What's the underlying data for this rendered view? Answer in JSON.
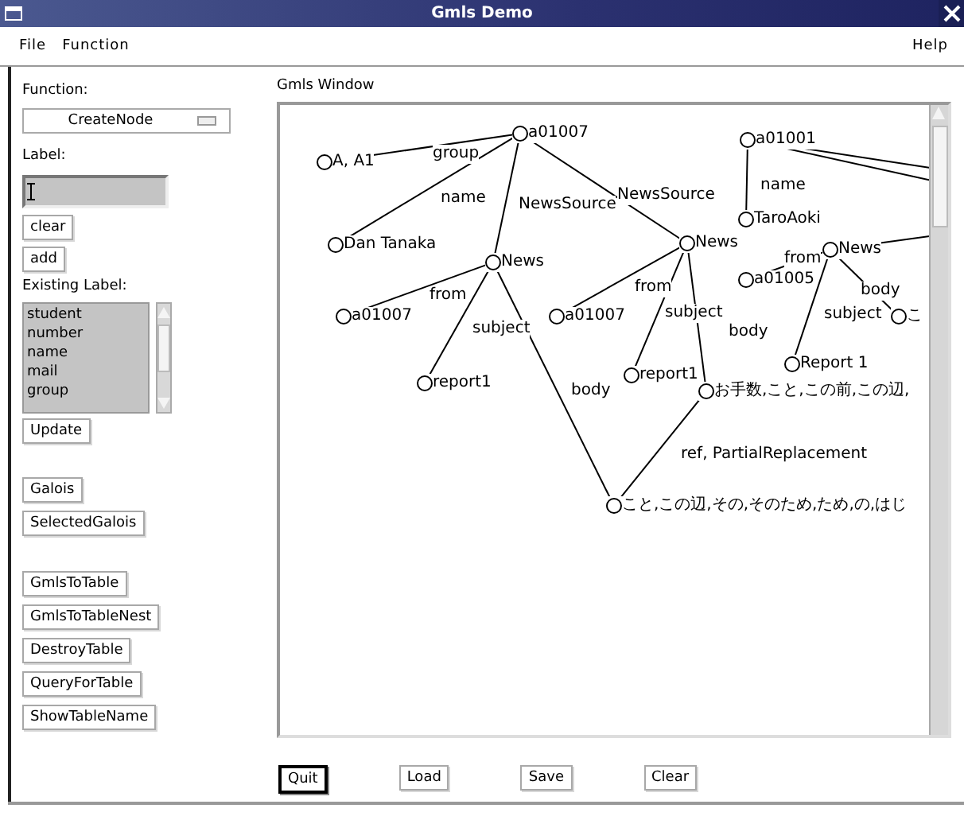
{
  "window": {
    "title": "Gmls Demo"
  },
  "menu_bar": {
    "left": [
      "File",
      "Function"
    ],
    "right": [
      "Help"
    ]
  },
  "sidebar": {
    "function_label": "Function:",
    "function_menu": {
      "value": "CreateNode"
    },
    "label_label": "Label:",
    "label_buttons": [
      "clear",
      "add"
    ],
    "existing_label": "Existing Label:",
    "existing_list": [
      "student",
      "number",
      "name",
      "mail",
      "group"
    ],
    "update_button": "Update",
    "galois_buttons": [
      "Galois",
      "SelectedGalois"
    ],
    "table_buttons": [
      "GmlsToTable",
      "GmlsToTableNest",
      "DestroyTable",
      "QueryForTable",
      "ShowTableName"
    ]
  },
  "graph": {
    "title": "Gmls Window",
    "nodes": [
      {
        "label": "a01007"
      },
      {
        "label": "a01001"
      },
      {
        "label": "A, A1"
      },
      {
        "label": "TaroAoki"
      },
      {
        "label": "Dan Tanaka"
      },
      {
        "label": "News"
      },
      {
        "label": "News"
      },
      {
        "label": "News"
      },
      {
        "label": "a01005"
      },
      {
        "label": "a01007"
      },
      {
        "label": "a01007"
      },
      {
        "label": "こ"
      },
      {
        "label": "Report 1"
      },
      {
        "label": "report1"
      },
      {
        "label": "report1"
      },
      {
        "label": "お手数,こと,この前,この辺,"
      },
      {
        "label": "こと,この辺,その,そのため,ため,の,はじ"
      }
    ],
    "edges": [
      {
        "label": "group"
      },
      {
        "label": "name"
      },
      {
        "label": "NewsSource"
      },
      {
        "label": "NewsSource"
      },
      {
        "label": "from"
      },
      {
        "label": "subject"
      },
      {
        "label": "body"
      },
      {
        "label": "from"
      },
      {
        "label": "subject"
      },
      {
        "label": "body"
      },
      {
        "label": "ref, PartialReplacement"
      },
      {
        "label": "name"
      },
      {
        "label": "from"
      },
      {
        "label": "body"
      },
      {
        "label": "subject"
      }
    ]
  },
  "bottom_buttons": [
    {
      "label": "Quit",
      "default": true
    },
    {
      "label": "Load",
      "default": false
    },
    {
      "label": "Save",
      "default": false
    },
    {
      "label": "Clear",
      "default": false
    }
  ]
}
